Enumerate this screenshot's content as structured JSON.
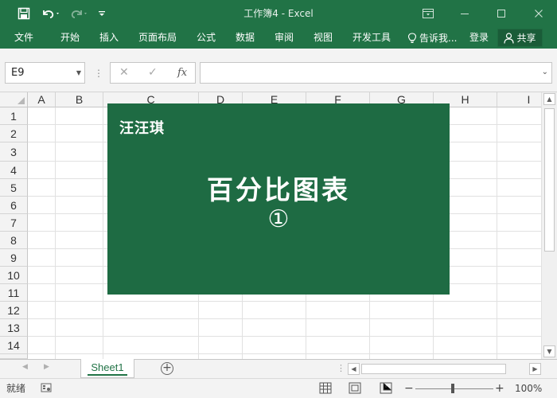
{
  "window": {
    "title": "工作簿4 - Excel"
  },
  "quick_access": {
    "save_icon": "save-icon",
    "undo_icon": "undo-icon",
    "redo_icon": "redo-icon",
    "customize_icon": "customize-qat-icon"
  },
  "ribbon": {
    "tabs": [
      {
        "label": "文件"
      },
      {
        "label": "开始"
      },
      {
        "label": "插入"
      },
      {
        "label": "页面布局"
      },
      {
        "label": "公式"
      },
      {
        "label": "数据"
      },
      {
        "label": "审阅"
      },
      {
        "label": "视图"
      },
      {
        "label": "开发工具"
      }
    ],
    "tell_me": "告诉我...",
    "signin": "登录",
    "share": "共享"
  },
  "formula_bar": {
    "name_box": "E9",
    "cancel_glyph": "✕",
    "enter_glyph": "✓",
    "fx_label": "fx",
    "content": ""
  },
  "grid": {
    "columns": [
      "A",
      "B",
      "C",
      "D",
      "E",
      "F",
      "G",
      "H",
      "I"
    ],
    "rows": [
      "1",
      "2",
      "3",
      "4",
      "5",
      "6",
      "7",
      "8",
      "9",
      "10",
      "11",
      "12",
      "13",
      "14"
    ]
  },
  "card": {
    "brand": "汪汪琪",
    "title": "百分比图表",
    "number": "①",
    "color": "#1e6b43"
  },
  "sheets": {
    "tabs": [
      {
        "label": "Sheet1"
      }
    ],
    "add_label": "+"
  },
  "status": {
    "ready": "就绪",
    "zoom": "100%",
    "zoom_minus": "−",
    "zoom_plus": "+"
  },
  "colors": {
    "accent": "#217346"
  }
}
